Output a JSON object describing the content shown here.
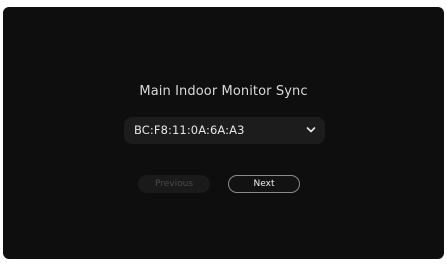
{
  "sync": {
    "title": "Main Indoor Monitor Sync",
    "device_select": {
      "selected_value": "BC:F8:11:0A:6A:A3",
      "icon": "chevron-down-icon"
    },
    "buttons": {
      "previous_label": "Previous",
      "previous_state": "disabled",
      "next_label": "Next"
    }
  },
  "colors": {
    "background": "#0e0e0e",
    "select_background": "#1c1c1c",
    "text_primary": "#e6e6e6",
    "text_disabled": "#4a4a4a",
    "next_border": "#8a8a8a"
  }
}
